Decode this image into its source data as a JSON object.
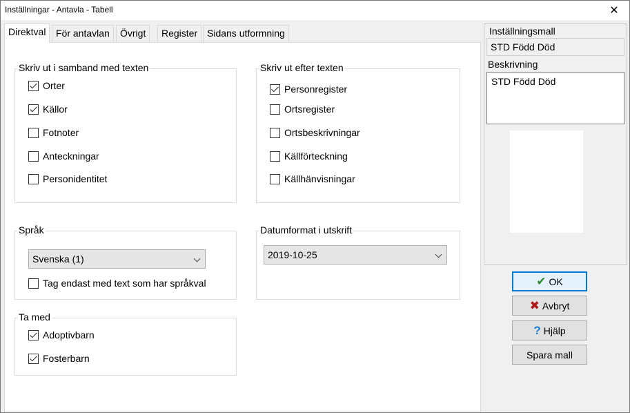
{
  "window": {
    "title": "Inställningar - Antavla - Tabell"
  },
  "tabs": [
    {
      "label": "Direktval"
    },
    {
      "label": "För antavlan"
    },
    {
      "label": "Övrigt"
    },
    {
      "label": "Register"
    },
    {
      "label": "Sidans utformning"
    }
  ],
  "groups": {
    "print_with_text": {
      "title": "Skriv ut i samband med texten",
      "items": [
        {
          "label": "Orter",
          "checked": true
        },
        {
          "label": "Källor",
          "checked": true
        },
        {
          "label": "Fotnoter",
          "checked": false
        },
        {
          "label": "Anteckningar",
          "checked": false
        },
        {
          "label": "Personidentitet",
          "checked": false
        }
      ]
    },
    "print_after_text": {
      "title": "Skriv ut efter texten",
      "items": [
        {
          "label": "Personregister",
          "checked": true
        },
        {
          "label": "Ortsregister",
          "checked": false
        },
        {
          "label": "Ortsbeskrivningar",
          "checked": false
        },
        {
          "label": "Källförteckning",
          "checked": false
        },
        {
          "label": "Källhänvisningar",
          "checked": false
        }
      ]
    },
    "language": {
      "title": "Språk",
      "selected": "Svenska (1)",
      "option_label": "Tag endast med text som har språkval",
      "option_checked": false
    },
    "date_format": {
      "title": "Datumformat i utskrift",
      "selected": "2019-10-25"
    },
    "include": {
      "title": "Ta med",
      "items": [
        {
          "label": "Adoptivbarn",
          "checked": true
        },
        {
          "label": "Fosterbarn",
          "checked": true
        }
      ]
    }
  },
  "template": {
    "label": "Inställningsmall",
    "value": "STD Född Död",
    "description_label": "Beskrivning",
    "description": "STD Född Död"
  },
  "buttons": {
    "ok": "OK",
    "cancel": "Avbryt",
    "help": "Hjälp",
    "save_template": "Spara mall"
  },
  "colors": {
    "ok_icon": "#2e8b2e",
    "cancel_icon": "#b01818",
    "help_icon": "#1a7fd0",
    "focus_border": "#0078d7"
  },
  "icons": {
    "ok": "check-icon",
    "cancel": "x-icon",
    "help": "question-icon",
    "close": "close-icon"
  }
}
